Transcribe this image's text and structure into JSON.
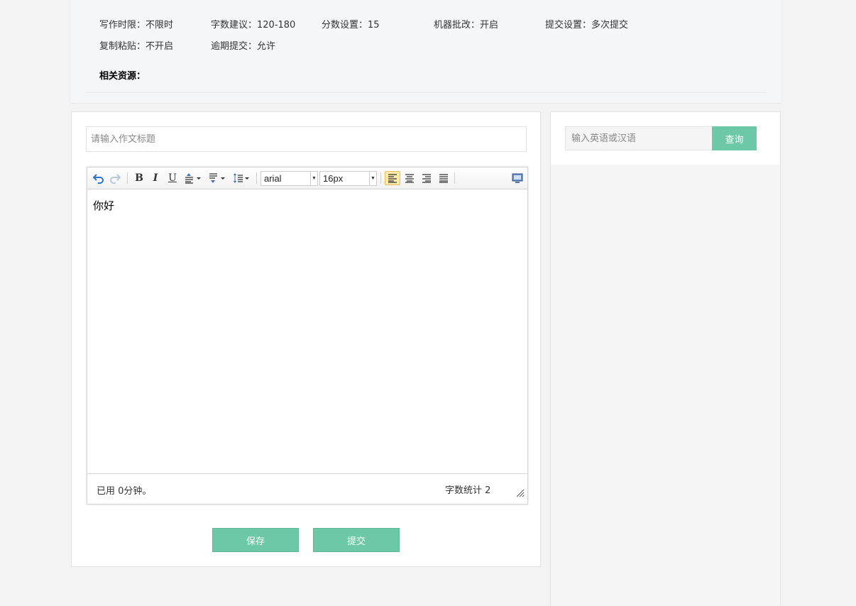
{
  "info": {
    "time_limit": "写作时限：不限时",
    "word_suggest": "字数建议：120-180",
    "score": "分数设置：15",
    "machine_grading": "机器批改：开启",
    "submit_setting": "提交设置：多次提交",
    "copy_paste": "复制粘贴：不开启",
    "late_submit": "逾期提交：允许",
    "resources_label": "相关资源："
  },
  "editor": {
    "title_placeholder": "请输入作文标题",
    "font_family": "arial",
    "font_size": "16px",
    "content": "你好",
    "elapsed": "已用 0分钟。",
    "word_count": "字数统计 2",
    "toolbar_icons": [
      "undo-icon",
      "redo-icon",
      "bold-icon",
      "italic-icon",
      "underline-icon",
      "rowspacing-top-icon",
      "rowspacing-bottom-icon",
      "line-height-icon",
      "align-left-icon",
      "align-center-icon",
      "align-right-icon",
      "align-justify-icon",
      "preview-icon"
    ],
    "active_align": "left"
  },
  "actions": {
    "save_label": "保存",
    "submit_label": "提交"
  },
  "dictionary": {
    "placeholder": "输入英语或汉语",
    "search_label": "查询"
  },
  "colors": {
    "accent": "#6cc8a7",
    "page_bg": "#f3f3f3",
    "info_bg": "#f5f6f8"
  }
}
